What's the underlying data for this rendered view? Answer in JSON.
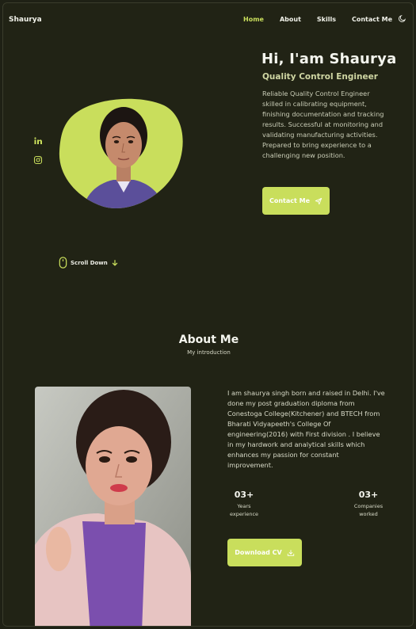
{
  "header": {
    "logo": "Shaurya",
    "nav": [
      "Home",
      "About",
      "Skills",
      "Contact Me"
    ],
    "active_nav": "Home",
    "theme_icon": "moon-icon"
  },
  "hero": {
    "title": "Hi, I'am Shaurya",
    "subtitle": "Quality Control Engineer",
    "description": "Reliable Quality Control Engineer skilled in calibrating equipment, finishing documentation and tracking results. Successful at monitoring and validating manufacturing activities. Prepared to bring experience to a challenging new position.",
    "contact_button": "Contact Me",
    "contact_icon": "send-icon",
    "socials": [
      "linkedin-icon",
      "instagram-icon"
    ],
    "scroll_label": "Scroll Down"
  },
  "about": {
    "title": "About Me",
    "subtitle": "My introduction",
    "text": "I am shaurya singh born and raised in Delhi. I've done my post graduation diploma from Conestoga College(Kitchener) and BTECH from Bharati Vidyapeeth's College Of engineering(2016) with First division . I believe in my hardwork and analytical skills which enhances my passion for constant improvement.",
    "stats": [
      {
        "number": "03+",
        "label_line1": "Years",
        "label_line2": "experience"
      },
      {
        "number": "03+",
        "label_line1": "Companies",
        "label_line2": "worked"
      }
    ],
    "cv_button": "Download CV",
    "cv_icon": "download-icon"
  },
  "colors": {
    "background": "#212315",
    "accent": "#c9de5c",
    "text": "#ecede5"
  }
}
